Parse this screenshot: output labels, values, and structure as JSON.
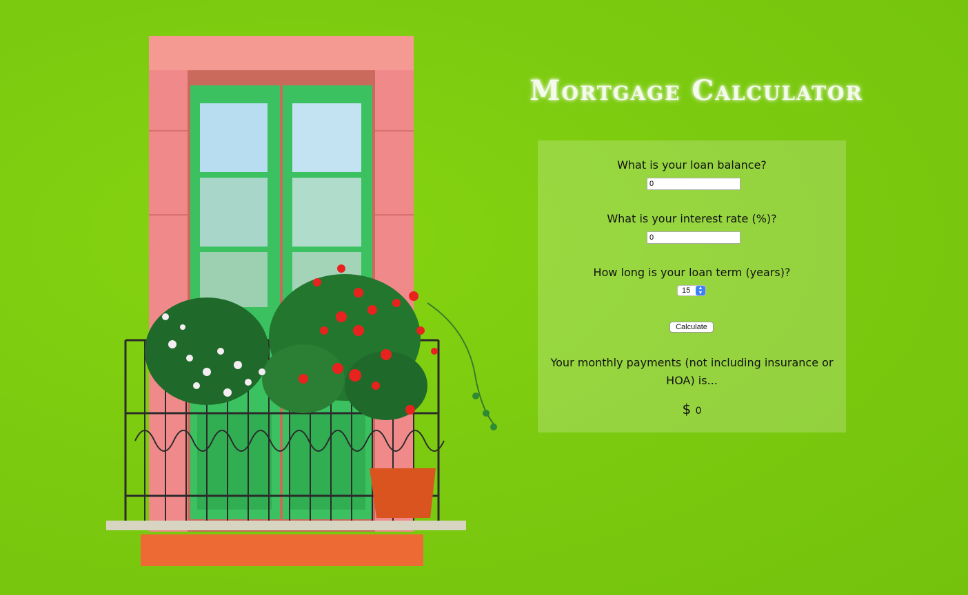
{
  "header": {
    "title": "Mortgage Calculator"
  },
  "form": {
    "loan_balance": {
      "question": "What is your loan balance?",
      "value": "0"
    },
    "interest_rate": {
      "question": "What is your interest rate (%)?",
      "value": "0"
    },
    "loan_term": {
      "question": "How long is your loan term (years)?",
      "selected": "15"
    },
    "calculate_label": "Calculate"
  },
  "result": {
    "label": "Your monthly payments (not including insurance or HOA) is...",
    "currency": "$",
    "amount": "0"
  },
  "colors": {
    "wall_green": "#7ccb10",
    "frame_pink": "#f08a8a",
    "door_green": "#3bbf5c",
    "flower_red": "#e8231f"
  }
}
